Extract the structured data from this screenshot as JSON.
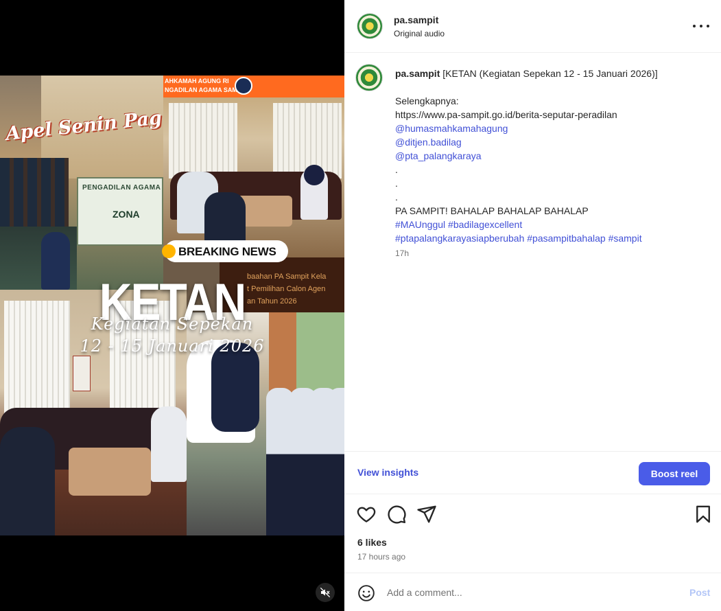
{
  "media": {
    "overlay": {
      "apel": "Apel Senin Pag",
      "banner_line1": "AHKAMAH AGUNG RI",
      "banner_line2": "NGADILAN AGAMA SAMPIT",
      "sign_line1": "PENGADILAN AGAMA",
      "sign_line2": "ZONA",
      "breaking": "BREAKING NEWS",
      "cap1": "baahan PA Sampit Kela",
      "cap2": "t Pemilihan Calon Agen",
      "cap3": "an Tahun 2026",
      "title": "KETAN",
      "subtitle": "Kegiatan Sepekan",
      "dates": "12 - 15 Januari 2026"
    },
    "mute_icon": "speaker-muted-icon"
  },
  "header": {
    "username": "pa.sampit",
    "subtitle": "Original audio"
  },
  "caption": {
    "username": "pa.sampit",
    "title": "[KETAN (Kegiatan Sepekan 12 - 15 Januari 2026)]",
    "lines": [
      {
        "text": "",
        "link": false
      },
      {
        "text": "Selengkapnya:",
        "link": false
      },
      {
        "text": "https://www.pa-sampit.go.id/berita-seputar-peradilan",
        "link": false
      },
      {
        "text": "@humasmahkamahagung",
        "link": true
      },
      {
        "text": "@ditjen.badilag",
        "link": true
      },
      {
        "text": "@pta_palangkaraya",
        "link": true
      },
      {
        "text": ".",
        "link": false
      },
      {
        "text": ".",
        "link": false
      },
      {
        "text": ".",
        "link": false
      },
      {
        "text": "PA SAMPIT! BAHALAP BAHALAP BAHALAP",
        "link": false
      },
      {
        "text": "#MAUnggul #badilagexcellent",
        "link": true
      },
      {
        "text": "#ptapalangkarayasiapberubah #pasampitbahalap #sampit",
        "link": true
      }
    ],
    "time": "17h"
  },
  "insights": {
    "view_label": "View insights",
    "boost_label": "Boost reel"
  },
  "actions": {
    "likes": "6 likes",
    "ago": "17 hours ago"
  },
  "comment": {
    "placeholder": "Add a comment...",
    "post_label": "Post"
  },
  "colors": {
    "link": "#4150d6",
    "boost": "#4a5ce8",
    "post_disabled": "#b3c6f7"
  }
}
